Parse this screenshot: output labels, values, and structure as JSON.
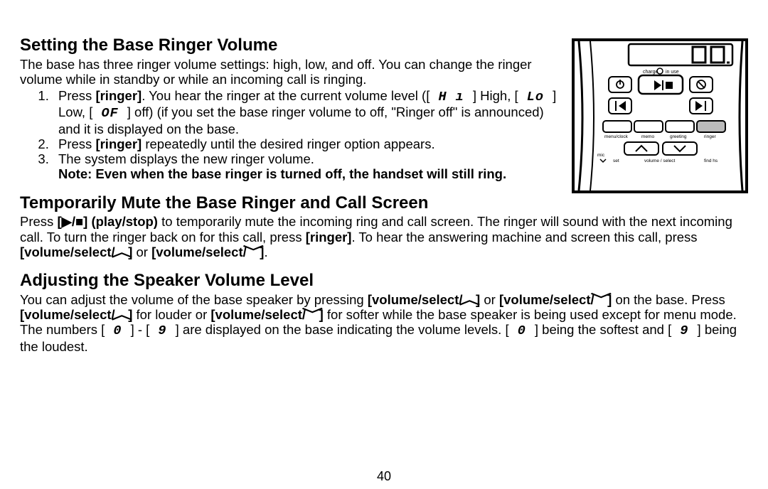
{
  "pageNumber": "40",
  "section1": {
    "heading": "Setting the Base Ringer Volume",
    "intro": "The base has three ringer volume settings: high, low, and off. You can change the ringer volume while in standby or while an incoming call is ringing.",
    "step1_a": "Press ",
    "step1_b": "[ringer]",
    "step1_c": ". You hear the ringer at the current volume level ([",
    "step1_hi": " H ı ",
    "step1_d": "] High, [",
    "step1_lo": " Lo ",
    "step1_e": "] Low, [",
    "step1_of": " OF ",
    "step1_f": "] off) (if you set the base ringer volume to off, \"Ringer off\" is announced) and it is displayed on the base.",
    "step2_a": "Press ",
    "step2_b": "[ringer]",
    "step2_c": " repeatedly until the desired ringer option appears.",
    "step3": "The system displays the new ringer volume.",
    "note": "Note: Even when the base ringer is turned off, the handset will still ring."
  },
  "section2": {
    "heading": "Temporarily Mute the Base Ringer and Call Screen",
    "p_a": "Press ",
    "p_b": "[▶/■] (play/stop)",
    "p_c": " to temporarily mute the incoming ring and call screen. The ringer will sound with the next incoming call. To turn the ringer back on for this call, press ",
    "p_d": "[ringer]",
    "p_e": ". To hear the answering machine and screen this call, press ",
    "p_f": "[volume/select/",
    "p_g": "]",
    "p_h": " or ",
    "p_i": "[volume/select/",
    "p_j": "]",
    "p_k": "."
  },
  "section3": {
    "heading": "Adjusting the Speaker Volume Level",
    "p_a": "You can adjust the volume of the base speaker by pressing ",
    "p_b": "[volume/select/",
    "p_c": "]",
    "p_d": " or ",
    "p_e": "[volume/select/",
    "p_f": "]",
    "p_g": " on the base. Press ",
    "p_h": "[volume/select/",
    "p_i": "]",
    "p_j": " for louder or ",
    "p_k": "[volume/select/",
    "p_l": "]",
    "p_m": " for softer while the base speaker is being used except for menu mode. The numbers [",
    "p_n": " 0 ",
    "p_o": "] - [",
    "p_p": " 9 ",
    "p_q": "] are displayed on the base indicating the volume levels. [",
    "p_r": " 0 ",
    "p_s": "] being the softest and [",
    "p_t": " 9 ",
    "p_u": "] being the loudest."
  },
  "figure": {
    "labels": {
      "charge": "charge",
      "inuse": "in use",
      "menu": "menu/clock",
      "memo": "memo",
      "greeting": "greeting",
      "ringer": "ringer",
      "mic": "mic",
      "set": "set",
      "volsel": "volume / select",
      "findhs": "find hs"
    }
  }
}
